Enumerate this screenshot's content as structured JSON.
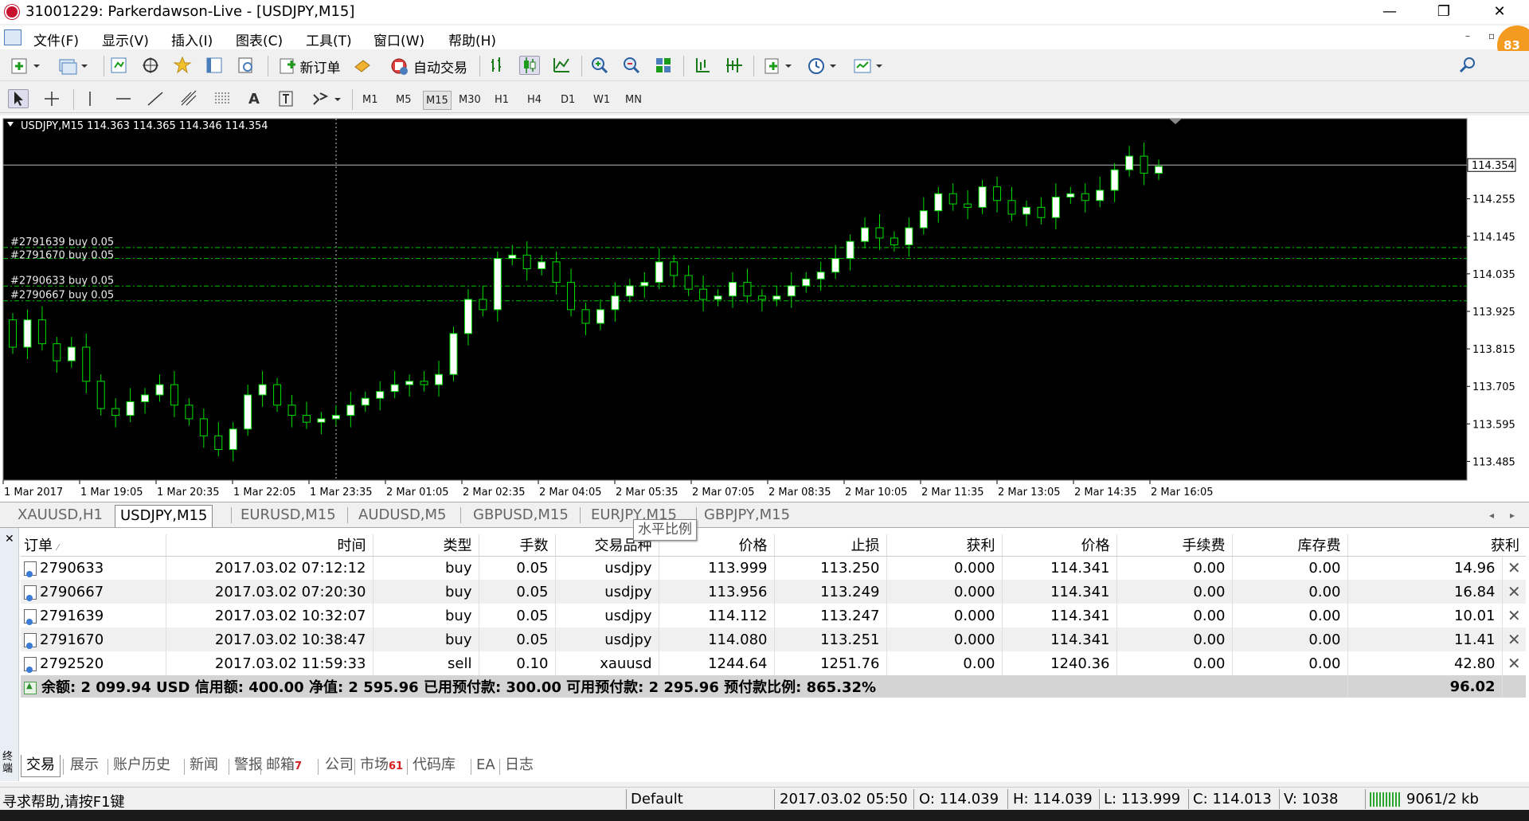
{
  "window": {
    "title": "31001229: Parkerdawson-Live - [USDJPY,M15]"
  },
  "menu": [
    "文件(F)",
    "显示(V)",
    "插入(I)",
    "图表(C)",
    "工具(T)",
    "窗口(W)",
    "帮助(H)"
  ],
  "avatar_text": "83",
  "toolbar": {
    "new_order": "新订单",
    "auto_trade": "自动交易"
  },
  "timeframes": [
    "M1",
    "M5",
    "M15",
    "M30",
    "H1",
    "H4",
    "D1",
    "W1",
    "MN"
  ],
  "active_timeframe": "M15",
  "chart": {
    "header": "USDJPY,M15  114.363 114.365 114.346 114.354",
    "current_price": "114.354",
    "price_axis": [
      "114.255",
      "114.145",
      "114.035",
      "113.925",
      "113.815",
      "113.705",
      "113.595",
      "113.485"
    ],
    "time_axis": [
      "1 Mar 2017",
      "1 Mar 19:05",
      "1 Mar 20:35",
      "1 Mar 22:05",
      "1 Mar 23:35",
      "2 Mar 01:05",
      "2 Mar 02:35",
      "2 Mar 04:05",
      "2 Mar 05:35",
      "2 Mar 07:05",
      "2 Mar 08:35",
      "2 Mar 10:05",
      "2 Mar 11:35",
      "2 Mar 13:05",
      "2 Mar 14:35",
      "2 Mar 16:05"
    ],
    "order_lines": [
      {
        "label": "#2791639 buy 0.05",
        "price": 114.112
      },
      {
        "label": "#2791670 buy 0.05",
        "price": 114.08
      },
      {
        "label": "#2790633 buy 0.05",
        "price": 113.999
      },
      {
        "label": "#2790667 buy 0.05",
        "price": 113.956
      }
    ],
    "colors": {
      "background": "#000000",
      "bull_fill": "#ffffff",
      "bear_fill": "#000000",
      "candle_stroke": "#00e000",
      "order_line": "#00c000",
      "grid_text": "#ffffff"
    }
  },
  "chart_tabs": [
    "XAUUSD,H1",
    "USDJPY,M15",
    "EURUSD,M15",
    "AUDUSD,M5",
    "GBPUSD,M15",
    "EURJPY,M15",
    "GBPJPY,M15"
  ],
  "active_chart_tab": "USDJPY,M15",
  "tooltip": "水平比例",
  "terminal": {
    "side_label": "终端",
    "columns": [
      "订单",
      "时间",
      "类型",
      "手数",
      "交易品种",
      "价格",
      "止损",
      "获利",
      "价格",
      "手续费",
      "库存费",
      "获利"
    ],
    "rows": [
      [
        "2790633",
        "2017.03.02 07:12:12",
        "buy",
        "0.05",
        "usdjpy",
        "113.999",
        "113.250",
        "0.000",
        "114.341",
        "0.00",
        "0.00",
        "14.96"
      ],
      [
        "2790667",
        "2017.03.02 07:20:30",
        "buy",
        "0.05",
        "usdjpy",
        "113.956",
        "113.249",
        "0.000",
        "114.341",
        "0.00",
        "0.00",
        "16.84"
      ],
      [
        "2791639",
        "2017.03.02 10:32:07",
        "buy",
        "0.05",
        "usdjpy",
        "114.112",
        "113.247",
        "0.000",
        "114.341",
        "0.00",
        "0.00",
        "10.01"
      ],
      [
        "2791670",
        "2017.03.02 10:38:47",
        "buy",
        "0.05",
        "usdjpy",
        "114.080",
        "113.251",
        "0.000",
        "114.341",
        "0.00",
        "0.00",
        "11.41"
      ],
      [
        "2792520",
        "2017.03.02 11:59:33",
        "sell",
        "0.10",
        "xauusd",
        "1244.64",
        "1251.76",
        "0.00",
        "1240.36",
        "0.00",
        "0.00",
        "42.80"
      ]
    ],
    "summary_text": "余额: 2 099.94 USD  信用额: 400.00  净值: 2 595.96  已用预付款: 300.00  可用预付款: 2 295.96  预付款比例: 865.32%",
    "summary_profit": "96.02",
    "tabs": [
      {
        "label": "交易",
        "badge": ""
      },
      {
        "label": "展示",
        "badge": ""
      },
      {
        "label": "账户历史",
        "badge": ""
      },
      {
        "label": "新闻",
        "badge": ""
      },
      {
        "label": "警报",
        "badge": ""
      },
      {
        "label": "邮箱",
        "badge": "7"
      },
      {
        "label": "公司",
        "badge": ""
      },
      {
        "label": "市场",
        "badge": "61"
      },
      {
        "label": "代码库",
        "badge": ""
      },
      {
        "label": "EA",
        "badge": ""
      },
      {
        "label": "日志",
        "badge": ""
      }
    ],
    "active_tab": "交易"
  },
  "status": {
    "help": "寻求帮助,请按F1键",
    "profile": "Default",
    "datetime": "2017.03.02 05:50",
    "open": "O: 114.039",
    "high": "H: 114.039",
    "low": "L: 113.999",
    "close": "C: 114.013",
    "volume": "V: 1038",
    "traffic": "9061/2 kb"
  }
}
